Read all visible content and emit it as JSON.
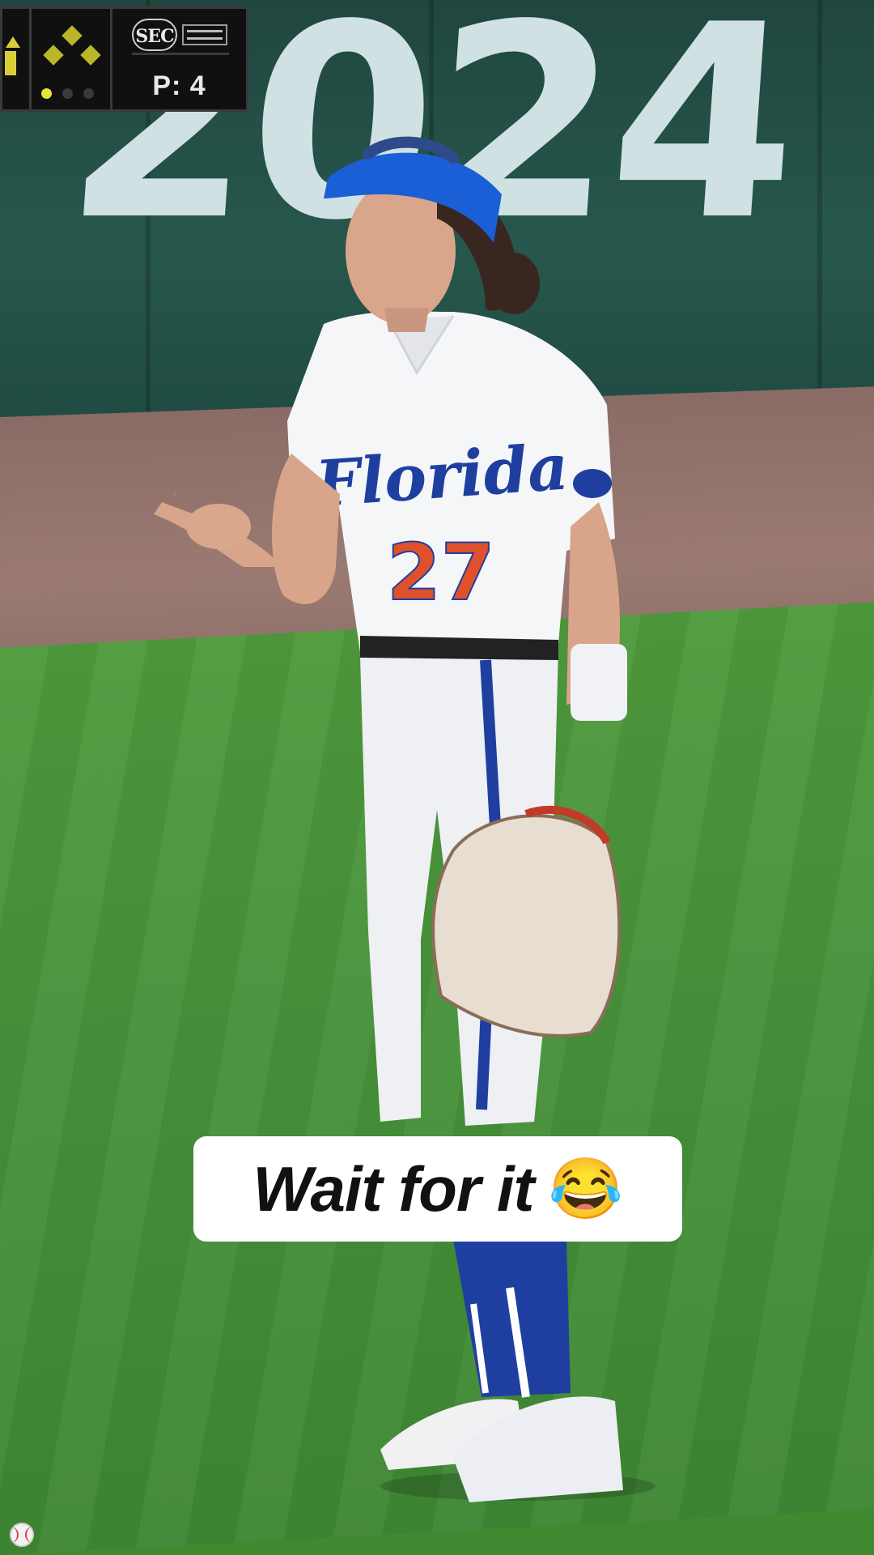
{
  "scoreboard": {
    "network_logo_text": "SEC",
    "pitch_count": "P: 4",
    "outs_shown": 1
  },
  "wall": {
    "year_text": "2024"
  },
  "player": {
    "jersey_team": "Florida",
    "jersey_number": "27"
  },
  "caption": {
    "text": "Wait for it",
    "emoji": "😂"
  },
  "watermark": {
    "icon": "softball-icon"
  },
  "colors": {
    "jersey_blue": "#1f3fa0",
    "jersey_orange": "#e0502a",
    "visor_blue": "#1a5fd6",
    "grass": "#47923a",
    "wall": "#27574c"
  }
}
